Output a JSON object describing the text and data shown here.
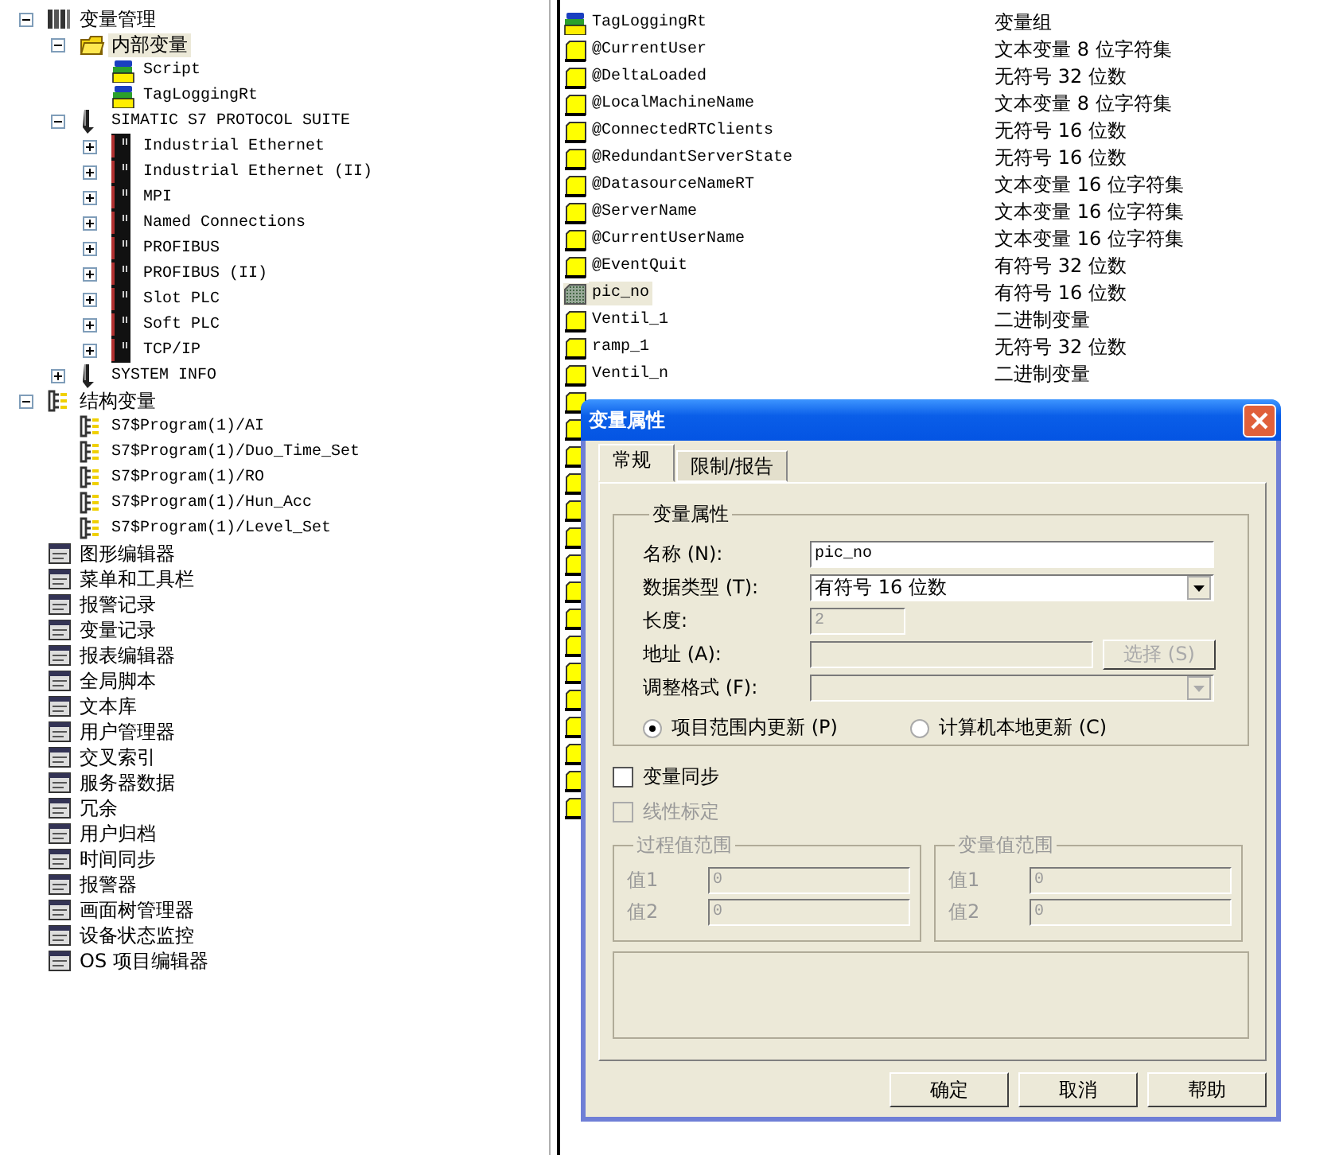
{
  "tree": [
    {
      "label": "变量管理",
      "kind": "rack",
      "expanded": true,
      "selected": false,
      "children": [
        {
          "label": "内部变量",
          "kind": "folder",
          "expanded": true,
          "selected": true,
          "children": [
            {
              "label": "Script",
              "kind": "group",
              "selected": false
            },
            {
              "label": "TagLoggingRt",
              "kind": "group",
              "selected": false
            }
          ]
        },
        {
          "label": "SIMATIC S7 PROTOCOL SUITE",
          "kind": "driver",
          "expanded": true,
          "selected": false,
          "children": [
            {
              "label": "Industrial Ethernet",
              "kind": "channel",
              "expanded": false,
              "selected": false
            },
            {
              "label": "Industrial Ethernet (II)",
              "kind": "channel",
              "expanded": false,
              "selected": false
            },
            {
              "label": "MPI",
              "kind": "channel",
              "expanded": false,
              "selected": false
            },
            {
              "label": "Named Connections",
              "kind": "channel",
              "expanded": false,
              "selected": false
            },
            {
              "label": "PROFIBUS",
              "kind": "channel",
              "expanded": false,
              "selected": false
            },
            {
              "label": "PROFIBUS (II)",
              "kind": "channel",
              "expanded": false,
              "selected": false
            },
            {
              "label": "Slot PLC",
              "kind": "channel",
              "expanded": false,
              "selected": false
            },
            {
              "label": "Soft PLC",
              "kind": "channel",
              "expanded": false,
              "selected": false
            },
            {
              "label": "TCP/IP",
              "kind": "channel",
              "expanded": false,
              "selected": false
            }
          ]
        },
        {
          "label": "SYSTEM INFO",
          "kind": "driver",
          "expanded": false,
          "selected": false
        }
      ]
    },
    {
      "label": "结构变量",
      "kind": "struct",
      "expanded": true,
      "selected": false,
      "children": [
        {
          "label": "S7$Program(1)/AI",
          "kind": "struct",
          "selected": false
        },
        {
          "label": "S7$Program(1)/Duo_Time_Set",
          "kind": "struct",
          "selected": false
        },
        {
          "label": "S7$Program(1)/RO",
          "kind": "struct",
          "selected": false
        },
        {
          "label": "S7$Program(1)/Hun_Acc",
          "kind": "struct",
          "selected": false
        },
        {
          "label": "S7$Program(1)/Level_Set",
          "kind": "struct",
          "selected": false
        }
      ]
    },
    {
      "label": "图形编辑器",
      "kind": "editor",
      "selected": false
    },
    {
      "label": "菜单和工具栏",
      "kind": "editor",
      "selected": false
    },
    {
      "label": "报警记录",
      "kind": "editor",
      "selected": false
    },
    {
      "label": "变量记录",
      "kind": "editor",
      "selected": false
    },
    {
      "label": "报表编辑器",
      "kind": "editor",
      "selected": false
    },
    {
      "label": "全局脚本",
      "kind": "editor",
      "selected": false
    },
    {
      "label": "文本库",
      "kind": "editor",
      "selected": false
    },
    {
      "label": "用户管理器",
      "kind": "editor",
      "selected": false
    },
    {
      "label": "交叉索引",
      "kind": "editor",
      "selected": false
    },
    {
      "label": "服务器数据",
      "kind": "editor",
      "selected": false
    },
    {
      "label": "冗余",
      "kind": "editor",
      "selected": false
    },
    {
      "label": "用户归档",
      "kind": "editor",
      "selected": false
    },
    {
      "label": "时间同步",
      "kind": "editor",
      "selected": false
    },
    {
      "label": "报警器",
      "kind": "editor",
      "selected": false
    },
    {
      "label": "画面树管理器",
      "kind": "editor",
      "selected": false
    },
    {
      "label": "设备状态监控",
      "kind": "editor",
      "selected": false
    },
    {
      "label": "OS 项目编辑器",
      "kind": "editor",
      "selected": false
    }
  ],
  "tag_list": [
    {
      "name": "TagLoggingRt",
      "type": "变量组",
      "kind": "group",
      "selected": false
    },
    {
      "name": "@CurrentUser",
      "type": "文本变量 8 位字符集",
      "kind": "tag",
      "selected": false
    },
    {
      "name": "@DeltaLoaded",
      "type": "无符号 32 位数",
      "kind": "tag",
      "selected": false
    },
    {
      "name": "@LocalMachineName",
      "type": "文本变量 8 位字符集",
      "kind": "tag",
      "selected": false
    },
    {
      "name": "@ConnectedRTClients",
      "type": "无符号 16 位数",
      "kind": "tag",
      "selected": false
    },
    {
      "name": "@RedundantServerState",
      "type": "无符号 16 位数",
      "kind": "tag",
      "selected": false
    },
    {
      "name": "@DatasourceNameRT",
      "type": "文本变量 16 位字符集",
      "kind": "tag",
      "selected": false
    },
    {
      "name": "@ServerName",
      "type": "文本变量 16 位字符集",
      "kind": "tag",
      "selected": false
    },
    {
      "name": "@CurrentUserName",
      "type": "文本变量 16 位字符集",
      "kind": "tag",
      "selected": false
    },
    {
      "name": "@EventQuit",
      "type": "有符号 32 位数",
      "kind": "tag",
      "selected": false
    },
    {
      "name": "pic_no",
      "type": "有符号 16 位数",
      "kind": "tag-hatched",
      "selected": true
    },
    {
      "name": "Ventil_1",
      "type": "二进制变量",
      "kind": "tag",
      "selected": false
    },
    {
      "name": "ramp_1",
      "type": "无符号 32 位数",
      "kind": "tag",
      "selected": false
    },
    {
      "name": "Ventil_n",
      "type": "二进制变量",
      "kind": "tag",
      "selected": false
    },
    {
      "kind": "tag",
      "selected": false
    },
    {
      "kind": "tag",
      "selected": false
    },
    {
      "kind": "tag",
      "selected": false
    },
    {
      "kind": "tag",
      "selected": false
    },
    {
      "kind": "tag",
      "selected": false
    },
    {
      "kind": "tag",
      "selected": false
    },
    {
      "kind": "tag",
      "selected": false
    },
    {
      "kind": "tag",
      "selected": false
    },
    {
      "kind": "tag",
      "selected": false
    },
    {
      "kind": "tag",
      "selected": false
    },
    {
      "kind": "tag",
      "selected": false
    },
    {
      "kind": "tag",
      "selected": false
    },
    {
      "kind": "tag",
      "selected": false
    },
    {
      "kind": "tag",
      "selected": false
    },
    {
      "kind": "tag",
      "selected": false
    },
    {
      "kind": "tag",
      "selected": false
    }
  ],
  "dialog": {
    "title": "变量属性",
    "tabs": [
      {
        "label": "常规",
        "selected": true
      },
      {
        "label": "限制/报告",
        "selected": false
      }
    ],
    "group_title": "变量属性",
    "fields": [
      {
        "label": "名称 (N):",
        "kind": "text",
        "value": "pic_no",
        "disabled": false
      },
      {
        "label": "数据类型 (T):",
        "kind": "select",
        "value": "有符号 16 位数",
        "disabled": false
      },
      {
        "label": "长度:",
        "kind": "short",
        "value": "2",
        "disabled": true
      },
      {
        "label": "地址 (A):",
        "kind": "text-button",
        "button": "选择 (S)",
        "disabled": true
      },
      {
        "label": "调整格式 (F):",
        "kind": "select",
        "disabled": true
      }
    ],
    "radios": [
      {
        "label": "项目范围内更新 (P)",
        "selected": true
      },
      {
        "label": "计算机本地更新 (C)",
        "selected": false
      }
    ],
    "checkboxes": [
      {
        "label": "变量同步",
        "checked": false,
        "disabled": false
      },
      {
        "label": "线性标定",
        "checked": false,
        "disabled": true
      }
    ],
    "ranges": [
      {
        "title": "过程值范围",
        "disabled": true,
        "rows": [
          {
            "label": "值1",
            "value": "0"
          },
          {
            "label": "值2",
            "value": "0"
          }
        ]
      },
      {
        "title": "变量值范围",
        "disabled": true,
        "rows": [
          {
            "label": "值1",
            "value": "0"
          },
          {
            "label": "值2",
            "value": "0"
          }
        ]
      }
    ],
    "buttons": [
      "确定",
      "取消",
      "帮助"
    ]
  }
}
